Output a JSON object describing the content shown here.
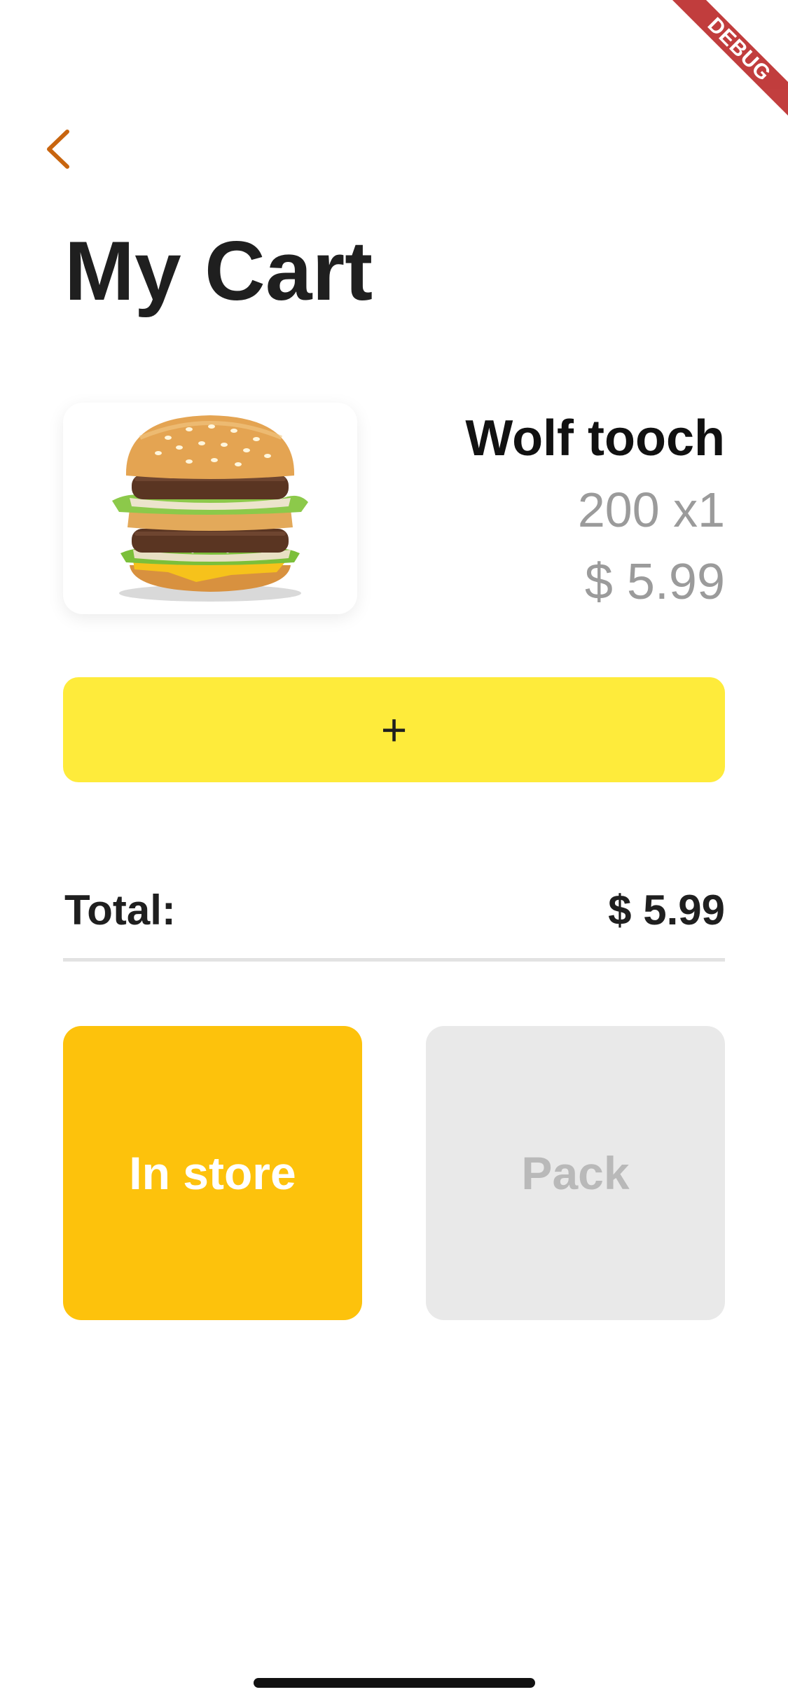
{
  "debug_banner": {
    "label": "DEBUG"
  },
  "header": {
    "back_icon": "chevron-left-icon",
    "title": "My Cart"
  },
  "cart": {
    "items": [
      {
        "image_icon": "burger-image",
        "name": "Wolf tooch",
        "quantity": "200 x1",
        "price": "$ 5.99"
      }
    ],
    "add_button_label": "+"
  },
  "summary": {
    "total_label": "Total:",
    "total_value": "$ 5.99"
  },
  "options": {
    "in_store": "In store",
    "pack": "Pack",
    "selected": "In store"
  },
  "colors": {
    "accent": "#c8650f",
    "add_button": "#feeb3b",
    "selected_option": "#fdc20c",
    "unselected_option": "#e9e9e9",
    "muted_text": "#9b9b9b"
  }
}
